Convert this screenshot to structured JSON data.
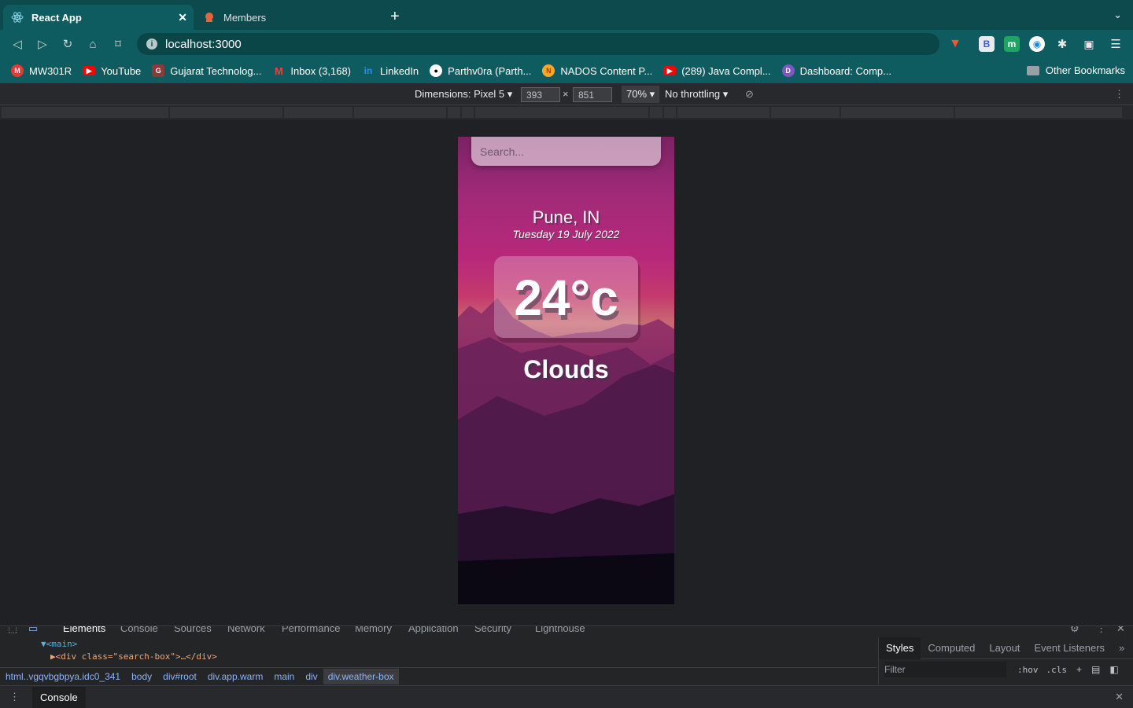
{
  "browser": {
    "tabs": [
      {
        "title": "React App",
        "icon": "react-icon",
        "active": true
      },
      {
        "title": "Members",
        "icon": "members-icon",
        "active": false
      }
    ],
    "url": "localhost:3000",
    "bookmarks": [
      {
        "label": "MW301R",
        "icon": "m-logo-icon",
        "color": "#e53935"
      },
      {
        "label": "YouTube",
        "icon": "youtube-icon",
        "color": "#ff0000"
      },
      {
        "label": "Gujarat Technolog...",
        "icon": "gtu-icon",
        "color": "#a33"
      },
      {
        "label": "Inbox (3,168)",
        "icon": "gmail-icon",
        "color": "#4285f4"
      },
      {
        "label": "LinkedIn",
        "icon": "linkedin-icon",
        "color": "#0a66c2"
      },
      {
        "label": "Parthv0ra (Parth...",
        "icon": "github-icon",
        "color": "#000000"
      },
      {
        "label": "NADOS Content P...",
        "icon": "nados-icon",
        "color": "#f9a825"
      },
      {
        "label": "(289) Java Compl...",
        "icon": "youtube-icon",
        "color": "#ff0000"
      },
      {
        "label": "Dashboard: Comp...",
        "icon": "dashboard-icon",
        "color": "#7e57c2"
      }
    ],
    "other_bookmarks": "Other Bookmarks"
  },
  "device_toolbar": {
    "dimensions": "Dimensions: Pixel 5",
    "width": "393",
    "height": "851",
    "zoom": "70%",
    "throttling": "No throttling"
  },
  "app": {
    "search_placeholder": "Search...",
    "location": "Pune, IN",
    "date": "Tuesday 19 July 2022",
    "temperature": "24°c",
    "weather": "Clouds"
  },
  "devtools": {
    "tabs": [
      "Elements",
      "Console",
      "Sources",
      "Network",
      "Performance",
      "Memory",
      "Application",
      "Security",
      "Lighthouse"
    ],
    "dom_line1": "▼<main>",
    "dom_line2": "▶<div class=\"search-box\">…</div>",
    "breadcrumbs": [
      "html..vgqvbgbpya.idc0_341",
      "body",
      "div#root",
      "div.app.warm",
      "main",
      "div",
      "div.weather-box"
    ],
    "side_tabs": [
      "Styles",
      "Computed",
      "Layout",
      "Event Listeners"
    ],
    "filter_placeholder": "Filter",
    "hov": ":hov",
    "cls": ".cls",
    "drawer_tab": "Console"
  }
}
